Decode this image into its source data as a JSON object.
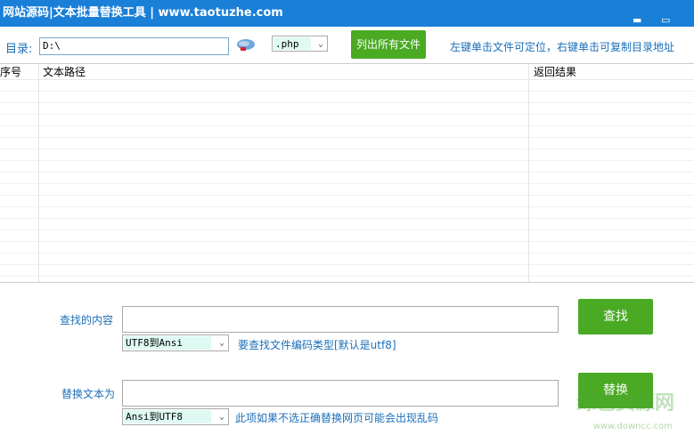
{
  "window": {
    "title": "网站源码|文本批量替换工具  | www.taotuzhe.com",
    "minimize": "▬",
    "maximize": "▭"
  },
  "toolbar": {
    "dir_label": "目录:",
    "dir_value": "D:\\",
    "ext_value": ".php",
    "list_button": "列出所有文件",
    "hint": "左键单击文件可定位，右键单击可复制目录地址"
  },
  "table": {
    "columns": [
      "序号",
      "文本路径",
      "返回结果"
    ]
  },
  "search": {
    "label": "查找的内容",
    "value": "",
    "encoding": "UTF8到Ansi",
    "note": "要查找文件编码类型[默认是utf8]",
    "button": "查找"
  },
  "replace": {
    "label": "替换文本为",
    "value": "",
    "encoding": "Ansi到UTF8",
    "note": "此项如果不选正确替换网页可能会出现乱码",
    "button": "替换"
  },
  "watermark": {
    "name": "绿色资源网",
    "url": "www.downcc.com"
  },
  "colors": {
    "titlebar": "#1a7fd7",
    "button": "#4aaa24",
    "label": "#1b6fb8"
  }
}
